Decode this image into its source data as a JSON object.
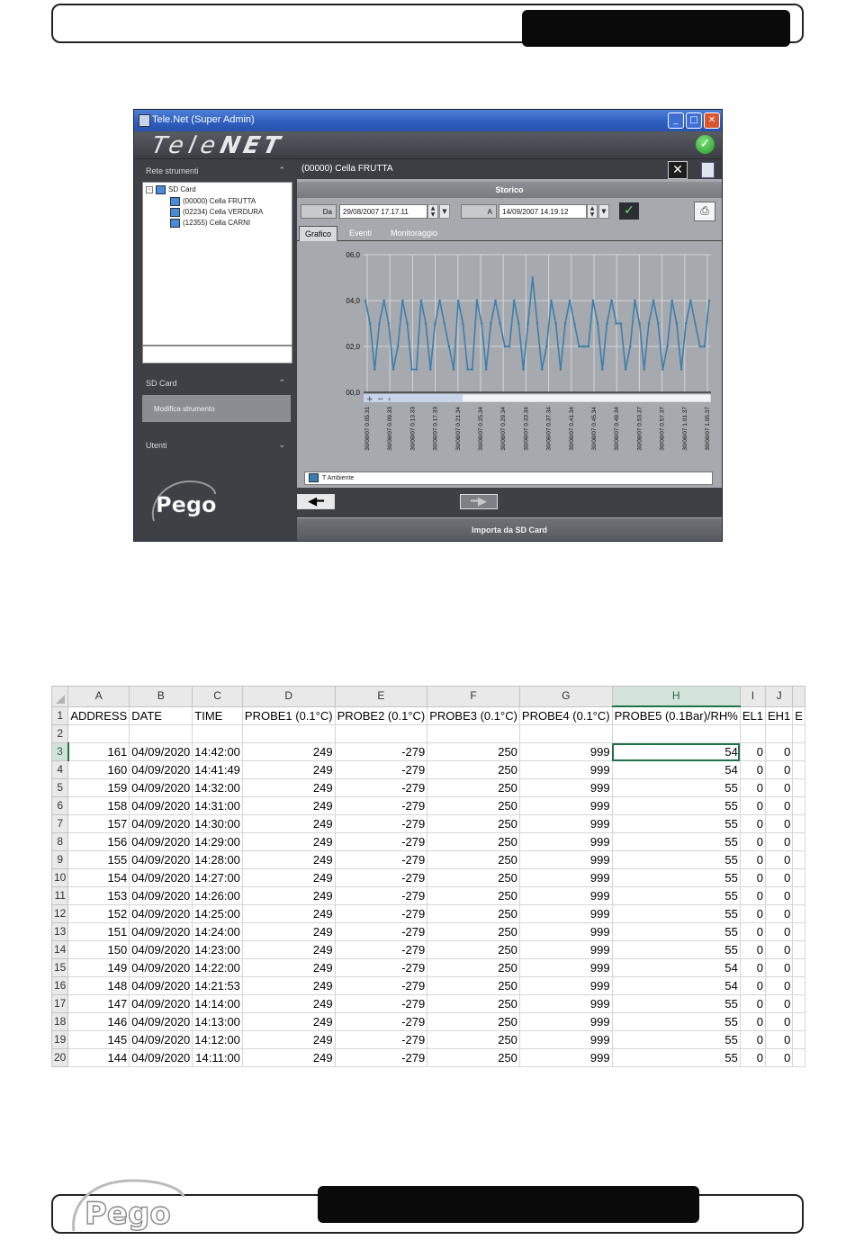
{
  "app": {
    "window_title": "Tele.Net (Super Admin)",
    "logo_part1": "Tele",
    "logo_part2": "NET",
    "left_panel": {
      "section_instruments": "Rete strumenti",
      "tree": [
        {
          "label": "SD Card"
        },
        {
          "label": "(00000) Cella FRUTTA"
        },
        {
          "label": "(02234) Cella VERDURA"
        },
        {
          "label": "(12355) Cella CARNI"
        }
      ],
      "section_sdcard": "SD Card",
      "menu_item": "Modifica strumento",
      "section_users": "Utenti",
      "brand": "Pego"
    },
    "instrument_title": "(00000) Cella FRUTTA",
    "storico_label": "Storico",
    "from_label": "Da",
    "from_value": "29/08/2007 17.17.11",
    "to_label": "A",
    "to_value": "14/09/2007 14.19.12",
    "tabs": [
      "Grafico",
      "Eventi",
      "Monitoraggio"
    ],
    "import_label": "Importa da SD Card"
  },
  "chart_data": {
    "type": "line",
    "y_ticks": [
      "06,0",
      "04,0",
      "02,0",
      "00,0"
    ],
    "ylim": [
      0,
      6
    ],
    "x_ticks": [
      "30/08/07 0.05.31",
      "30/08/07 0.09.33",
      "30/08/07 0.13.33",
      "30/08/07 0.17.33",
      "30/08/07 0.21.34",
      "30/08/07 0.25.34",
      "30/08/07 0.29.34",
      "30/08/07 0.33.34",
      "30/08/07 0.37.34",
      "30/08/07 0.41.34",
      "30/08/07 0.45.34",
      "30/08/07 0.49.34",
      "30/08/07 0.53.37",
      "30/08/07 0.57.37",
      "30/08/07 1.01.37",
      "30/08/07 1.05.37"
    ],
    "series": [
      {
        "name": "T Ambiente",
        "color": "#3b7fb0",
        "values": [
          4,
          3,
          1,
          3,
          4,
          3,
          1,
          2,
          4,
          3,
          1,
          1,
          4,
          3,
          1,
          3,
          4,
          3,
          2,
          1,
          4,
          3,
          1,
          1,
          4,
          3,
          1,
          3,
          4,
          3,
          2,
          2,
          4,
          3,
          1,
          3,
          5,
          3,
          1,
          2,
          4,
          3,
          1,
          3,
          4,
          3,
          2,
          2,
          2,
          4,
          3,
          1,
          3,
          4,
          3,
          3,
          1,
          2,
          4,
          3,
          1,
          3,
          4,
          3,
          1,
          2,
          4,
          3,
          1,
          3,
          4,
          3,
          2,
          2,
          4
        ]
      }
    ]
  },
  "sheet": {
    "col_letters": [
      "A",
      "B",
      "C",
      "D",
      "E",
      "F",
      "G",
      "H",
      "I",
      "J",
      ""
    ],
    "header": [
      "ADDRESS",
      "DATE",
      "TIME",
      "PROBE1 (0.1°C)",
      "PROBE2 (0.1°C)",
      "PROBE3 (0.1°C)",
      "PROBE4 (0.1°C)",
      "PROBE5 (0.1Bar)/RH%",
      "EL1",
      "EH1",
      "E"
    ],
    "rows": [
      [
        "161",
        "04/09/2020",
        "14:42:00",
        "249",
        "-279",
        "250",
        "999",
        "54",
        "0",
        "0"
      ],
      [
        "160",
        "04/09/2020",
        "14:41:49",
        "249",
        "-279",
        "250",
        "999",
        "54",
        "0",
        "0"
      ],
      [
        "159",
        "04/09/2020",
        "14:32:00",
        "249",
        "-279",
        "250",
        "999",
        "55",
        "0",
        "0"
      ],
      [
        "158",
        "04/09/2020",
        "14:31:00",
        "249",
        "-279",
        "250",
        "999",
        "55",
        "0",
        "0"
      ],
      [
        "157",
        "04/09/2020",
        "14:30:00",
        "249",
        "-279",
        "250",
        "999",
        "55",
        "0",
        "0"
      ],
      [
        "156",
        "04/09/2020",
        "14:29:00",
        "249",
        "-279",
        "250",
        "999",
        "55",
        "0",
        "0"
      ],
      [
        "155",
        "04/09/2020",
        "14:28:00",
        "249",
        "-279",
        "250",
        "999",
        "55",
        "0",
        "0"
      ],
      [
        "154",
        "04/09/2020",
        "14:27:00",
        "249",
        "-279",
        "250",
        "999",
        "55",
        "0",
        "0"
      ],
      [
        "153",
        "04/09/2020",
        "14:26:00",
        "249",
        "-279",
        "250",
        "999",
        "55",
        "0",
        "0"
      ],
      [
        "152",
        "04/09/2020",
        "14:25:00",
        "249",
        "-279",
        "250",
        "999",
        "55",
        "0",
        "0"
      ],
      [
        "151",
        "04/09/2020",
        "14:24:00",
        "249",
        "-279",
        "250",
        "999",
        "55",
        "0",
        "0"
      ],
      [
        "150",
        "04/09/2020",
        "14:23:00",
        "249",
        "-279",
        "250",
        "999",
        "55",
        "0",
        "0"
      ],
      [
        "149",
        "04/09/2020",
        "14:22:00",
        "249",
        "-279",
        "250",
        "999",
        "54",
        "0",
        "0"
      ],
      [
        "148",
        "04/09/2020",
        "14:21:53",
        "249",
        "-279",
        "250",
        "999",
        "54",
        "0",
        "0"
      ],
      [
        "147",
        "04/09/2020",
        "14:14:00",
        "249",
        "-279",
        "250",
        "999",
        "55",
        "0",
        "0"
      ],
      [
        "146",
        "04/09/2020",
        "14:13:00",
        "249",
        "-279",
        "250",
        "999",
        "55",
        "0",
        "0"
      ],
      [
        "145",
        "04/09/2020",
        "14:12:00",
        "249",
        "-279",
        "250",
        "999",
        "55",
        "0",
        "0"
      ],
      [
        "144",
        "04/09/2020",
        "14:11:00",
        "249",
        "-279",
        "250",
        "999",
        "55",
        "0",
        "0"
      ]
    ]
  }
}
